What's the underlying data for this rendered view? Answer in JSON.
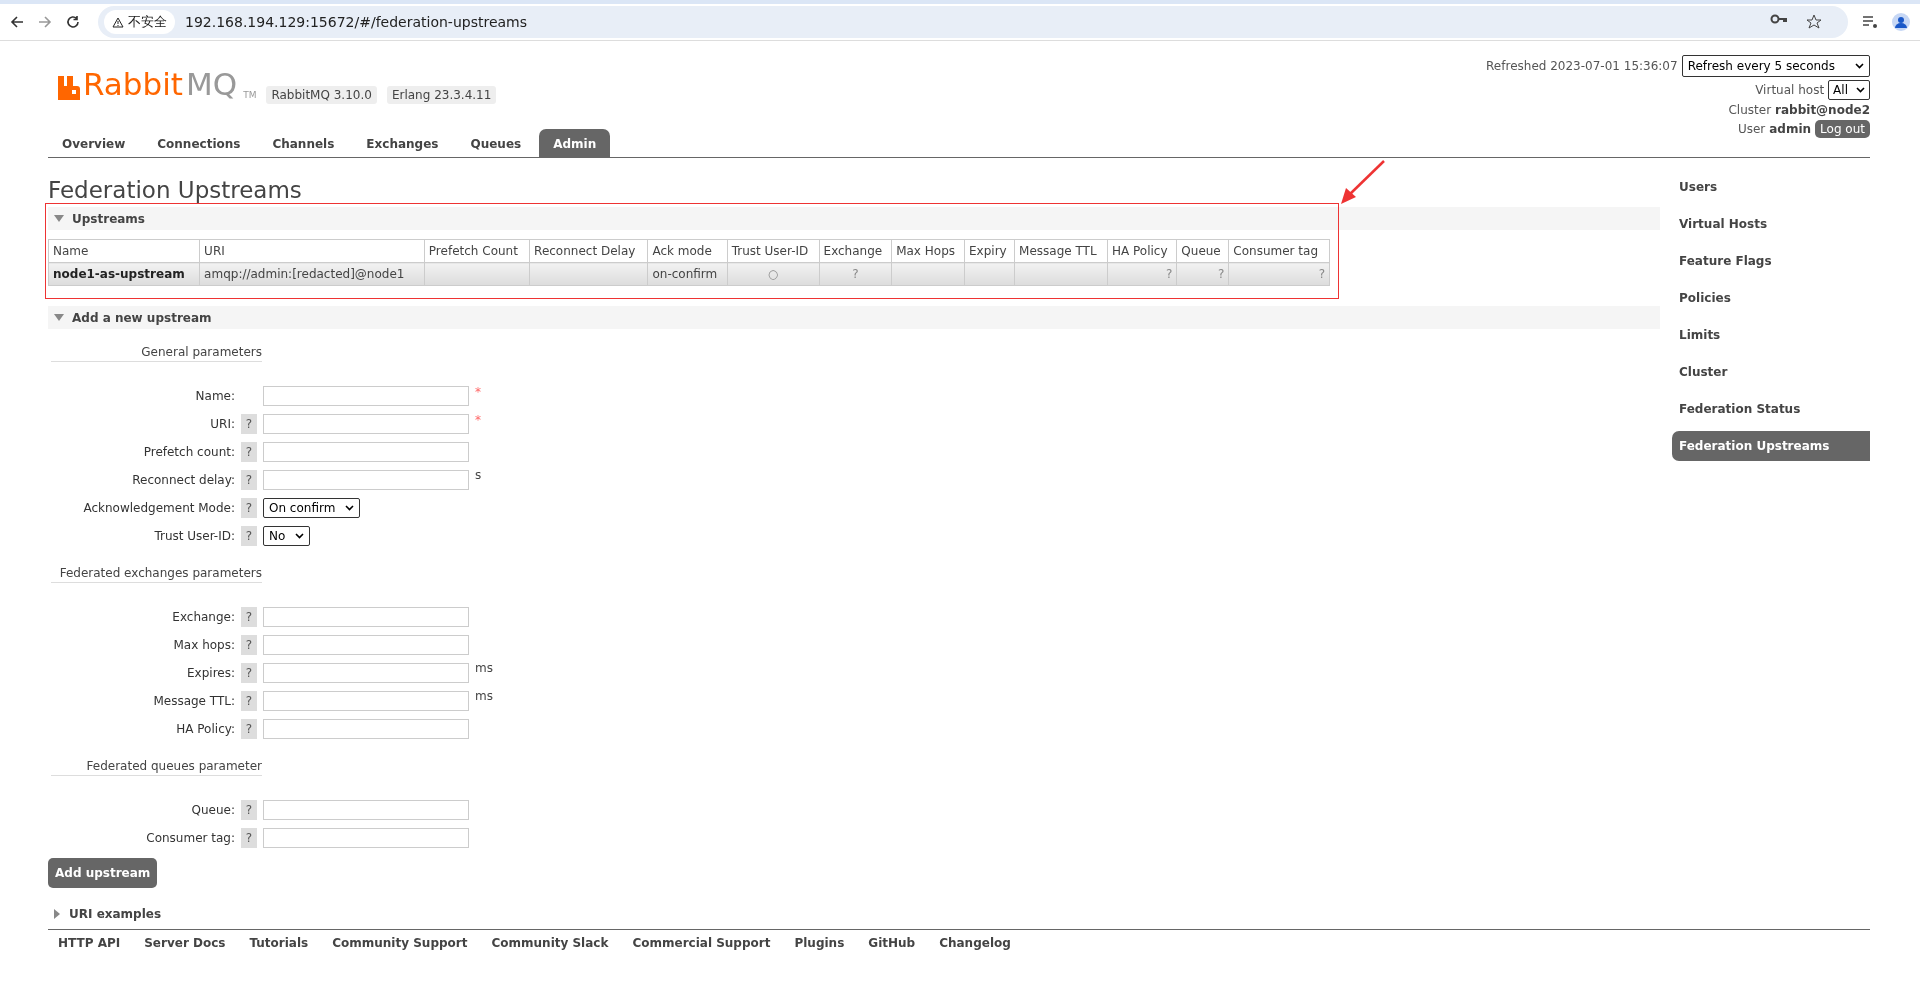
{
  "browser": {
    "security_label": "不安全",
    "url": "192.168.194.129:15672/#/federation-upstreams"
  },
  "header": {
    "logo_main": "Rabbit",
    "logo_mq": "MQ",
    "logo_tm": "TM",
    "versions": [
      "RabbitMQ 3.10.0",
      "Erlang 23.3.4.11"
    ],
    "refreshed": "Refreshed 2023-07-01 15:36:07",
    "refresh_select": "Refresh every 5 seconds",
    "vhost_label": "Virtual host",
    "vhost_select": "All",
    "cluster_label": "Cluster",
    "cluster": "rabbit@node2",
    "user_label": "User",
    "user": "admin",
    "logout": "Log out"
  },
  "tabs": [
    {
      "label": "Overview",
      "selected": false
    },
    {
      "label": "Connections",
      "selected": false
    },
    {
      "label": "Channels",
      "selected": false
    },
    {
      "label": "Exchanges",
      "selected": false
    },
    {
      "label": "Queues",
      "selected": false
    },
    {
      "label": "Admin",
      "selected": true
    }
  ],
  "page_title": "Federation Upstreams",
  "upstreams": {
    "title": "Upstreams",
    "expanded": true,
    "highlighted": true,
    "columns": [
      "Name",
      "URI",
      "Prefetch Count",
      "Reconnect Delay",
      "Ack mode",
      "Trust User-ID",
      "Exchange",
      "Max Hops",
      "Expiry",
      "Message TTL",
      "HA Policy",
      "Queue",
      "Consumer tag"
    ],
    "rows": [
      {
        "cells": [
          {
            "kind": "name",
            "text": "node1-as-upstream"
          },
          {
            "kind": "text",
            "text": "amqp://admin:[redacted]@node1"
          },
          {
            "kind": "empty"
          },
          {
            "kind": "empty"
          },
          {
            "kind": "text",
            "text": "on-confirm"
          },
          {
            "kind": "center",
            "text": "○"
          },
          {
            "kind": "center",
            "text": "?"
          },
          {
            "kind": "empty"
          },
          {
            "kind": "empty"
          },
          {
            "kind": "empty"
          },
          {
            "kind": "right",
            "text": "?"
          },
          {
            "kind": "right",
            "text": "?"
          },
          {
            "kind": "right",
            "text": "?"
          }
        ]
      }
    ]
  },
  "add_upstream": {
    "title": "Add a new upstream",
    "expanded": true,
    "groups": [
      {
        "title": "General parameters",
        "fields": [
          {
            "label": "Name:",
            "kind": "text",
            "required": "*"
          },
          {
            "label": "URI:",
            "kind": "text",
            "help": "?",
            "required": "*"
          },
          {
            "label": "Prefetch count:",
            "kind": "text",
            "help": "?"
          },
          {
            "label": "Reconnect delay:",
            "kind": "text",
            "help": "?",
            "unit": "s"
          },
          {
            "label": "Acknowledgement Mode:",
            "kind": "select",
            "help": "?",
            "value": "On confirm"
          },
          {
            "label": "Trust User-ID:",
            "kind": "select",
            "help": "?",
            "value": "No"
          }
        ]
      },
      {
        "title": "Federated exchanges parameters",
        "fields": [
          {
            "label": "Exchange:",
            "kind": "text",
            "help": "?"
          },
          {
            "label": "Max hops:",
            "kind": "text",
            "help": "?"
          },
          {
            "label": "Expires:",
            "kind": "text",
            "help": "?",
            "unit": "ms"
          },
          {
            "label": "Message TTL:",
            "kind": "text",
            "help": "?",
            "unit": "ms"
          },
          {
            "label": "HA Policy:",
            "kind": "text",
            "help": "?"
          }
        ]
      },
      {
        "title": "Federated queues parameter",
        "fields": [
          {
            "label": "Queue:",
            "kind": "text",
            "help": "?"
          },
          {
            "label": "Consumer tag:",
            "kind": "text",
            "help": "?"
          }
        ]
      }
    ],
    "submit": "Add upstream"
  },
  "uri_examples": {
    "title": "URI examples",
    "expanded": false
  },
  "sidebar": [
    {
      "label": "Users",
      "selected": false
    },
    {
      "label": "Virtual Hosts",
      "selected": false
    },
    {
      "label": "Feature Flags",
      "selected": false
    },
    {
      "label": "Policies",
      "selected": false
    },
    {
      "label": "Limits",
      "selected": false
    },
    {
      "label": "Cluster",
      "selected": false
    },
    {
      "label": "Federation Status",
      "selected": false
    },
    {
      "label": "Federation Upstreams",
      "selected": true
    }
  ],
  "footer": [
    "HTTP API",
    "Server Docs",
    "Tutorials",
    "Community Support",
    "Community Slack",
    "Commercial Support",
    "Plugins",
    "GitHub",
    "Changelog"
  ]
}
